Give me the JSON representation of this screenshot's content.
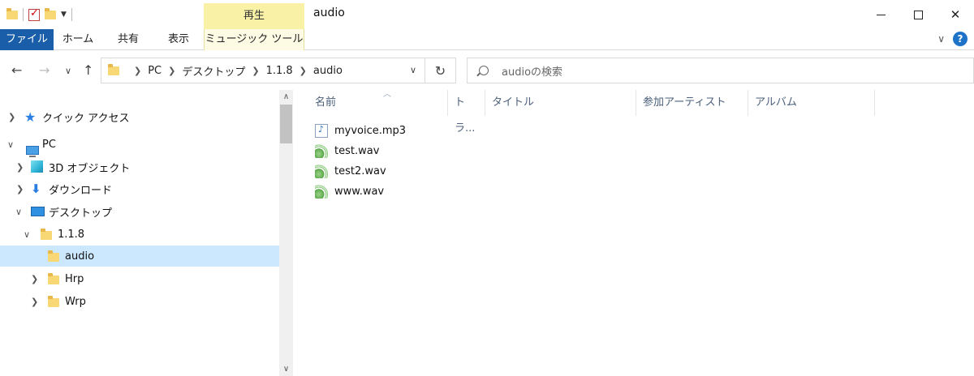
{
  "window": {
    "title": "audio",
    "context_tab_header": "再生"
  },
  "ribbon": {
    "tabs": [
      "ファイル",
      "ホーム",
      "共有",
      "表示",
      "ミュージック ツール"
    ]
  },
  "address": {
    "crumbs": [
      "PC",
      "デスクトップ",
      "1.1.8",
      "audio"
    ]
  },
  "search": {
    "placeholder": "audioの検索"
  },
  "tree": {
    "quick_access": "クイック アクセス",
    "pc": "PC",
    "objects_3d": "3D オブジェクト",
    "downloads": "ダウンロード",
    "desktop": "デスクトップ",
    "folder_118": "1.1.8",
    "audio": "audio",
    "hrp": "Hrp",
    "wrp": "Wrp"
  },
  "columns": {
    "name": "名前",
    "track": "トラ...",
    "title": "タイトル",
    "artist": "参加アーティスト",
    "album": "アルバム"
  },
  "files": [
    {
      "name": "myvoice.mp3",
      "type": "mp3"
    },
    {
      "name": "test.wav",
      "type": "wav"
    },
    {
      "name": "test2.wav",
      "type": "wav"
    },
    {
      "name": "www.wav",
      "type": "wav"
    }
  ]
}
